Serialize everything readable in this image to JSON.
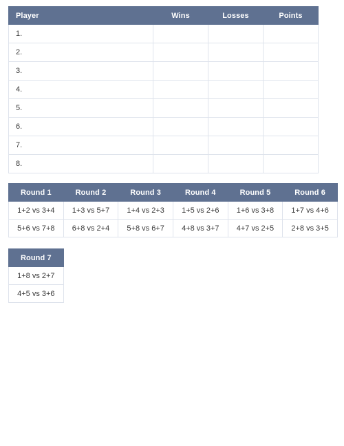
{
  "theme": {
    "header_bg": "#5f7191",
    "header_text": "#ffffff",
    "cell_border": "#dee3ec",
    "cell_bg": "#ffffff",
    "text": "#333333",
    "page_bg": "#ffffff"
  },
  "standings": {
    "columns": [
      {
        "label": "Player",
        "align": "left"
      },
      {
        "label": "Wins",
        "align": "center"
      },
      {
        "label": "Losses",
        "align": "center"
      },
      {
        "label": "Points",
        "align": "center"
      }
    ],
    "rows": [
      {
        "rank": "1.",
        "wins": "",
        "losses": "",
        "points": ""
      },
      {
        "rank": "2.",
        "wins": "",
        "losses": "",
        "points": ""
      },
      {
        "rank": "3.",
        "wins": "",
        "losses": "",
        "points": ""
      },
      {
        "rank": "4.",
        "wins": "",
        "losses": "",
        "points": ""
      },
      {
        "rank": "5.",
        "wins": "",
        "losses": "",
        "points": ""
      },
      {
        "rank": "6.",
        "wins": "",
        "losses": "",
        "points": ""
      },
      {
        "rank": "7.",
        "wins": "",
        "losses": "",
        "points": ""
      },
      {
        "rank": "8.",
        "wins": "",
        "losses": "",
        "points": ""
      }
    ]
  },
  "rounds_block_1": {
    "headers": [
      "Round 1",
      "Round 2",
      "Round 3",
      "Round 4",
      "Round 5",
      "Round 6"
    ],
    "matches": [
      [
        "1+2 vs 3+4",
        "1+3 vs 5+7",
        "1+4 vs 2+3",
        "1+5 vs 2+6",
        "1+6 vs 3+8",
        "1+7 vs 4+6"
      ],
      [
        "5+6 vs 7+8",
        "6+8 vs 2+4",
        "5+8 vs 6+7",
        "4+8 vs 3+7",
        "4+7 vs 2+5",
        "2+8 vs 3+5"
      ]
    ]
  },
  "rounds_block_2": {
    "headers": [
      "Round 7"
    ],
    "matches": [
      [
        "1+8 vs 2+7"
      ],
      [
        "4+5 vs 3+6"
      ]
    ]
  }
}
